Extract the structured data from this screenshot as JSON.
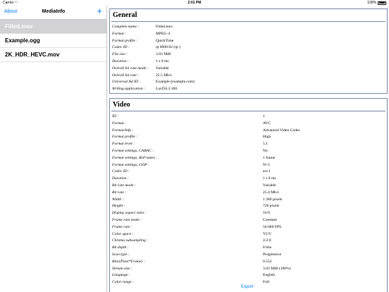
{
  "status": {
    "carrier": "Carrier",
    "wifi_icon": "wifi-icon",
    "time": "2:01 PM",
    "battery": "100%"
  },
  "sidebar": {
    "about_label": "About",
    "title": "MediaInfo",
    "add_icon": "+",
    "files": [
      "Filled.mov",
      "Example.ogg",
      "2K_HDR_HEVC.mov"
    ],
    "selected_index": 0
  },
  "general": {
    "title": "General",
    "rows": [
      {
        "k": "Complete name :",
        "v": "Filled.mov"
      },
      {
        "k": "Format :",
        "v": "MPEG-4"
      },
      {
        "k": "Format profile :",
        "v": "QuickTime"
      },
      {
        "k": "Codec ID :",
        "v": "qt 0000.02 (qt )"
      },
      {
        "k": "File size :",
        "v": "3.03 MiB"
      },
      {
        "k": "Duration :",
        "v": "1 s 0 ms"
      },
      {
        "k": "Overall bit rate mode :",
        "v": "Variable"
      },
      {
        "k": "Overall bit rate :",
        "v": "25.5 Mb/s"
      },
      {
        "k": "Universal Ad ID :",
        "v": "Example (example.com)"
      },
      {
        "k": "Writing application :",
        "v": "Lavf56.3.100"
      }
    ]
  },
  "video": {
    "title": "Video",
    "rows": [
      {
        "k": "ID :",
        "v": "1"
      },
      {
        "k": "Format :",
        "v": "AVC"
      },
      {
        "k": "Format/Info :",
        "v": "Advanced Video Codec"
      },
      {
        "k": "Format profile :",
        "v": "High"
      },
      {
        "k": "Format level :",
        "v": "5.1"
      },
      {
        "k": "Format settings, CABAC :",
        "v": "No"
      },
      {
        "k": "Format settings, ReFrames :",
        "v": "1 frame"
      },
      {
        "k": "Format settings, GOP :",
        "v": "N=1"
      },
      {
        "k": "Codec ID :",
        "v": "avc1"
      },
      {
        "k": "Duration :",
        "v": "1 s 0 ms"
      },
      {
        "k": "Bit rate mode :",
        "v": "Variable"
      },
      {
        "k": "Bit rate :",
        "v": "25.4 Mb/s"
      },
      {
        "k": "Width :",
        "v": "1 280 pixels"
      },
      {
        "k": "Height :",
        "v": "720 pixels"
      },
      {
        "k": "Display aspect ratio :",
        "v": "16:9"
      },
      {
        "k": "Frame rate mode :",
        "v": "Constant"
      },
      {
        "k": "Frame rate :",
        "v": "50.000 FPS"
      },
      {
        "k": "Color space :",
        "v": "YUV"
      },
      {
        "k": "Chroma subsampling :",
        "v": "4:2:0"
      },
      {
        "k": "Bit depth :",
        "v": "8 bits"
      },
      {
        "k": "Scan type :",
        "v": "Progressive"
      },
      {
        "k": "Bits/(Pixel*Frame) :",
        "v": "0.552"
      },
      {
        "k": "Stream size :",
        "v": "3.03 MiB (100%)"
      },
      {
        "k": "Language :",
        "v": "English"
      },
      {
        "k": "Color range :",
        "v": "Full"
      }
    ]
  },
  "toolbar": {
    "export_label": "Export"
  }
}
